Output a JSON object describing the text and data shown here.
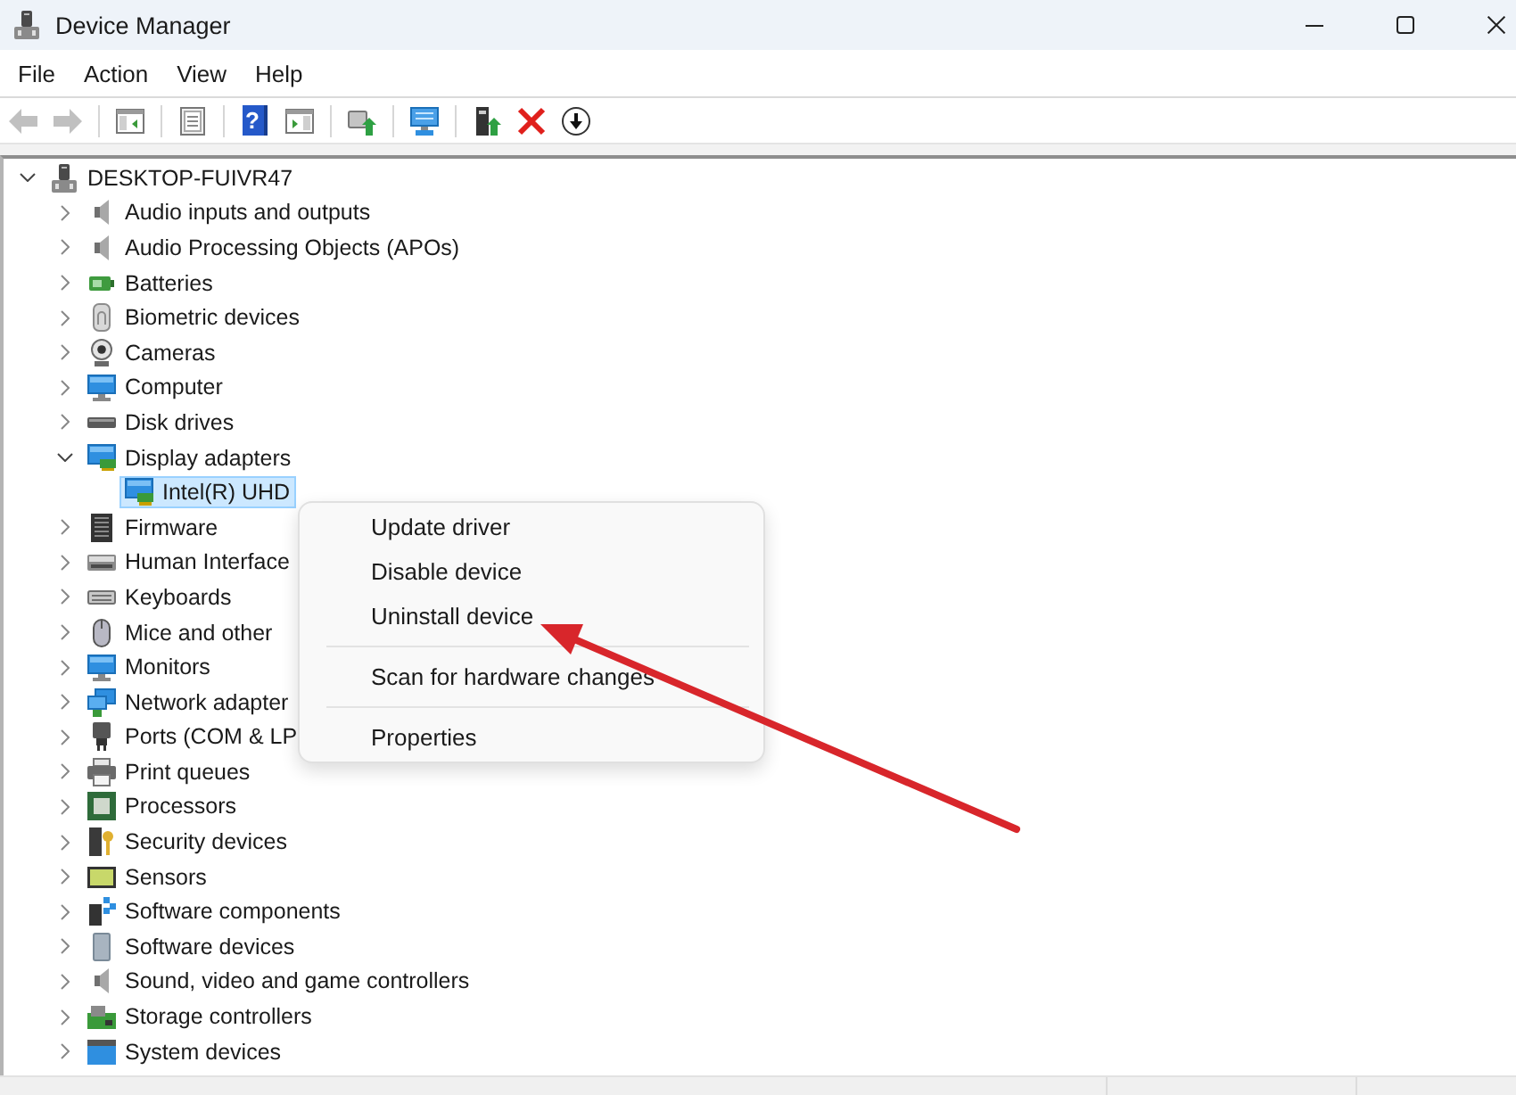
{
  "window": {
    "title": "Device Manager"
  },
  "menu_bar": [
    "File",
    "Action",
    "View",
    "Help"
  ],
  "toolbar": {
    "groups": [
      [
        {
          "kind": "back",
          "disabled": true
        },
        {
          "kind": "forward",
          "disabled": true
        }
      ],
      [
        {
          "kind": "console_tree",
          "disabled": false
        }
      ],
      [
        {
          "kind": "properties",
          "disabled": false
        }
      ],
      [
        {
          "kind": "help",
          "label": "?",
          "disabled": false
        },
        {
          "kind": "action_pane",
          "disabled": false
        }
      ],
      [
        {
          "kind": "update_driver",
          "disabled": false
        }
      ],
      [
        {
          "kind": "scan",
          "disabled": false
        }
      ],
      [
        {
          "kind": "enable",
          "disabled": false
        },
        {
          "kind": "uninstall",
          "disabled": false
        },
        {
          "kind": "disable",
          "disabled": false
        }
      ]
    ]
  },
  "tree": {
    "label": "DESKTOP-FUIVR47",
    "kind": "computer",
    "expanded": true,
    "selected": false,
    "children": [
      {
        "label": "Audio inputs and outputs",
        "kind": "speaker",
        "expanded": false,
        "selected": false
      },
      {
        "label": "Audio Processing Objects (APOs)",
        "kind": "speaker",
        "expanded": false,
        "selected": false
      },
      {
        "label": "Batteries",
        "kind": "battery",
        "expanded": false,
        "selected": false
      },
      {
        "label": "Biometric devices",
        "kind": "fingerprint",
        "expanded": false,
        "selected": false
      },
      {
        "label": "Cameras",
        "kind": "camera",
        "expanded": false,
        "selected": false
      },
      {
        "label": "Computer",
        "kind": "monitor",
        "expanded": false,
        "selected": false
      },
      {
        "label": "Disk drives",
        "kind": "disk",
        "expanded": false,
        "selected": false
      },
      {
        "label": "Display adapters",
        "kind": "display",
        "expanded": true,
        "selected": false,
        "children": [
          {
            "label": "Intel(R) UHD",
            "kind": "display",
            "selected": true
          }
        ]
      },
      {
        "label": "Firmware",
        "kind": "firmware",
        "expanded": false,
        "selected": false
      },
      {
        "label": "Human Interface",
        "kind": "hid",
        "expanded": false,
        "selected": false
      },
      {
        "label": "Keyboards",
        "kind": "keyboard",
        "expanded": false,
        "selected": false
      },
      {
        "label": "Mice and other",
        "kind": "mouse",
        "expanded": false,
        "selected": false
      },
      {
        "label": "Monitors",
        "kind": "monitor",
        "expanded": false,
        "selected": false
      },
      {
        "label": "Network adapter",
        "kind": "network",
        "expanded": false,
        "selected": false
      },
      {
        "label": "Ports (COM & LP",
        "kind": "port",
        "expanded": false,
        "selected": false
      },
      {
        "label": "Print queues",
        "kind": "printer",
        "expanded": false,
        "selected": false
      },
      {
        "label": "Processors",
        "kind": "processor",
        "expanded": false,
        "selected": false
      },
      {
        "label": "Security devices",
        "kind": "security",
        "expanded": false,
        "selected": false
      },
      {
        "label": "Sensors",
        "kind": "sensor",
        "expanded": false,
        "selected": false
      },
      {
        "label": "Software components",
        "kind": "component",
        "expanded": false,
        "selected": false
      },
      {
        "label": "Software devices",
        "kind": "software",
        "expanded": false,
        "selected": false
      },
      {
        "label": "Sound, video and game controllers",
        "kind": "speaker",
        "expanded": false,
        "selected": false
      },
      {
        "label": "Storage controllers",
        "kind": "storage",
        "expanded": false,
        "selected": false
      },
      {
        "label": "System devices",
        "kind": "system",
        "expanded": false,
        "selected": false
      }
    ]
  },
  "context_menu": {
    "groups": [
      [
        "Update driver",
        "Disable device",
        "Uninstall device"
      ],
      [
        "Scan for hardware changes"
      ],
      [
        "Properties"
      ]
    ]
  }
}
